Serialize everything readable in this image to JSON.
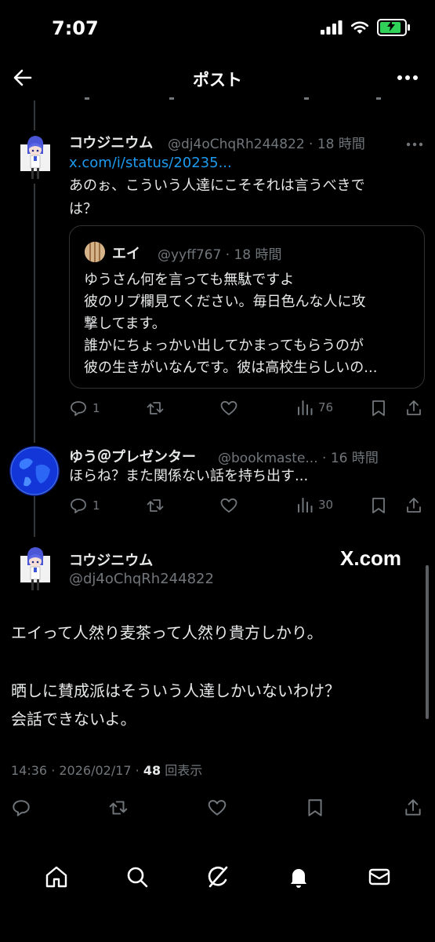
{
  "status_bar": {
    "time": "7:07"
  },
  "header": {
    "title": "ポスト"
  },
  "thread": [
    {
      "name": "コウジニウム",
      "meta": "@dj4oChqRh244822 · 18 時間",
      "link": "x.com/i/status/20235...",
      "text_lines": [
        "あのぉ、こういう人達にこそそれは言うべきで",
        "は？"
      ],
      "quote": {
        "name": "エイ",
        "meta": "@yyff767 · 18 時間",
        "lines": [
          "ゆうさん何を言っても無駄ですよ",
          "彼のリプ欄見てください。毎日色んな人に攻",
          "撃してます。",
          "誰かにちょっかい出してかまってもらうのが",
          "彼の生きがいなんです。彼は高校生らしいの..."
        ]
      },
      "actions": {
        "replies": "1",
        "views": "76"
      }
    },
    {
      "name": "ゆう＠プレゼンター",
      "meta": "@bookmaste... · 16 時間",
      "text_lines": [
        "ほらね？また関係ない話を持ち出す..."
      ],
      "actions": {
        "replies": "1",
        "views": "30"
      }
    }
  ],
  "main_post": {
    "name": "コウジニウム",
    "handle": "@dj4oChqRh244822",
    "watermark": "X.com",
    "paragraph1": "エイって人然り麦茶って人然り貴方しかり。",
    "paragraph2_line1": "晒しに賛成派はそういう人達しかいないわけ？",
    "paragraph2_line2": "会話できないよ。",
    "timestamp": "14:36 · 2026/02/17 · ",
    "views_count": "48",
    "views_label": " 回表示"
  },
  "icons": {
    "reply": "reply-icon",
    "retweet": "retweet-icon",
    "like": "heart-icon",
    "views": "views-icon",
    "bookmark": "bookmark-icon",
    "share": "share-icon"
  },
  "colors": {
    "link": "#1d9bf0",
    "muted": "#71767b",
    "text": "#e7e9ea",
    "background": "#000000",
    "battery": "#30d158"
  }
}
